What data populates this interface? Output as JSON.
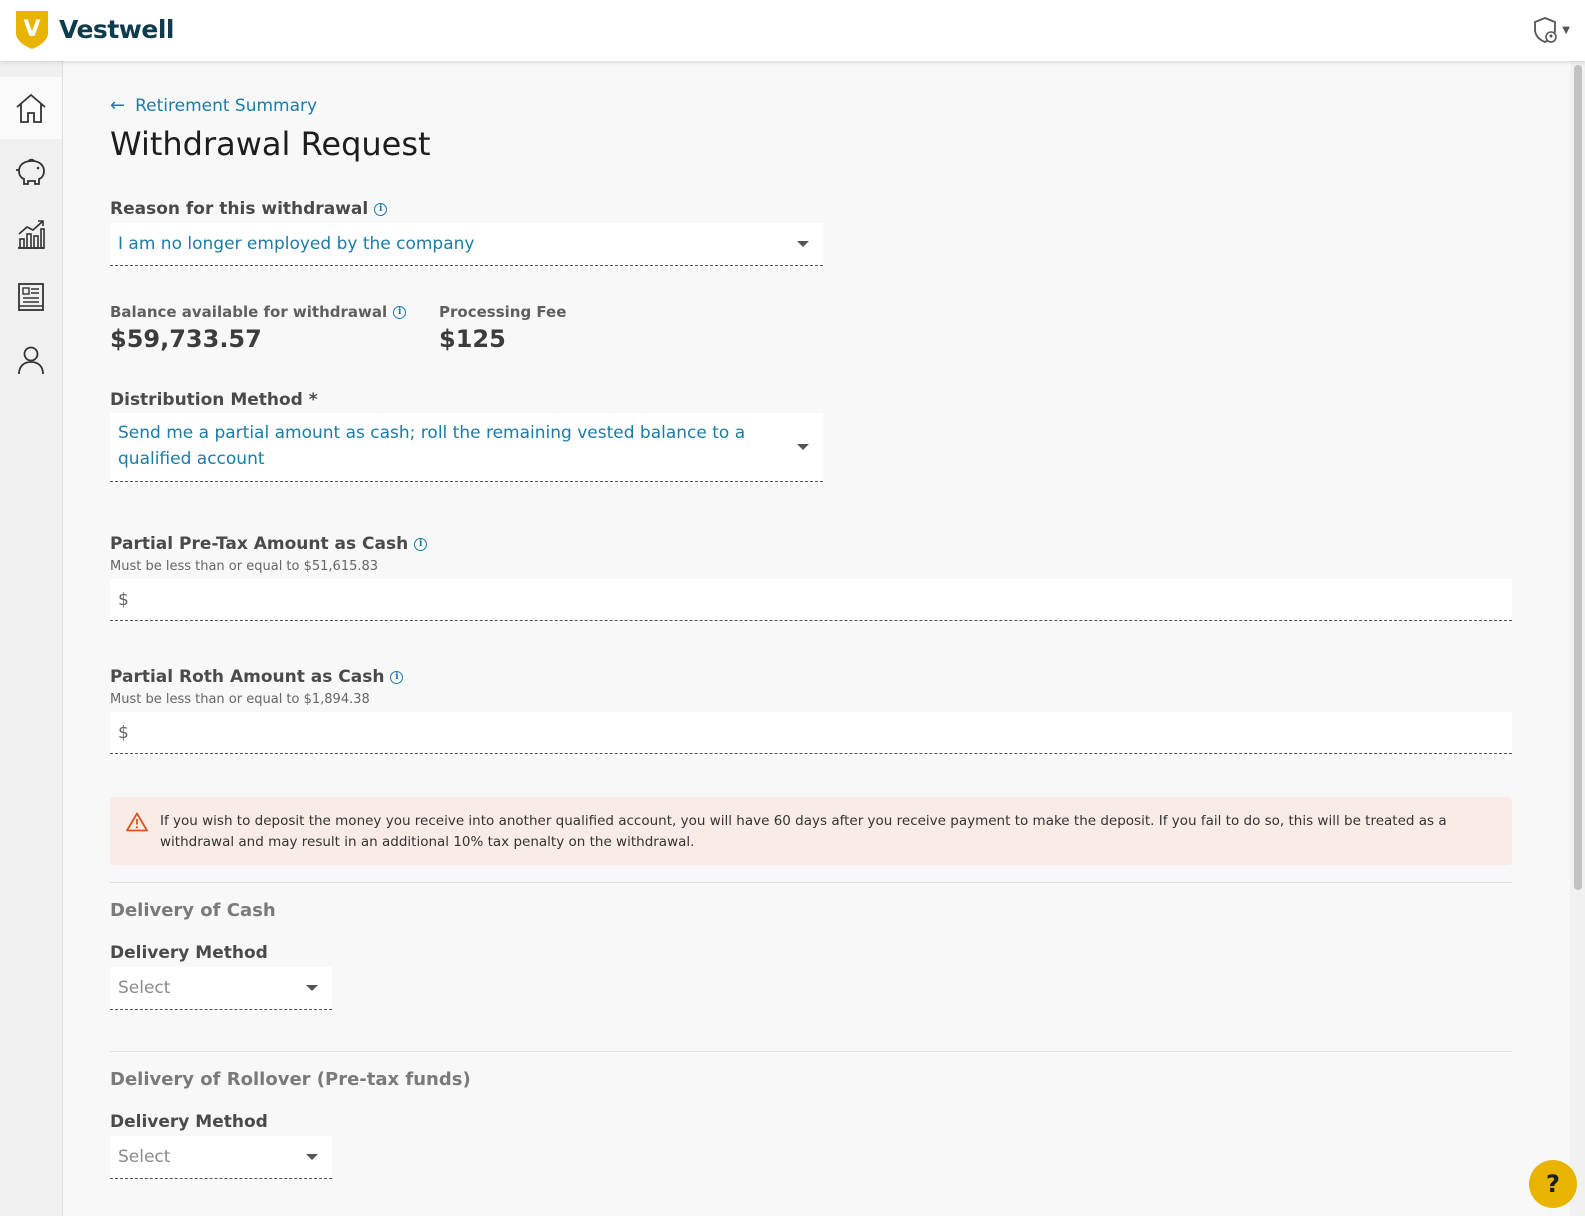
{
  "app": {
    "brand": "Vestwell",
    "logo_letter": "V",
    "colors": {
      "accent": "#1a7ca8",
      "brand_gold": "#e8b400",
      "navy": "#0f3b4f",
      "warning_bg": "#f9ece6",
      "warning_icon": "#d9531e"
    }
  },
  "sidebar": {
    "items": [
      {
        "icon": "home-icon"
      },
      {
        "icon": "piggy-bank-icon"
      },
      {
        "icon": "chart-icon"
      },
      {
        "icon": "document-icon"
      },
      {
        "icon": "user-icon"
      }
    ]
  },
  "page": {
    "back_link": "Retirement Summary",
    "title": "Withdrawal Request"
  },
  "form": {
    "reason": {
      "label": "Reason for this withdrawal",
      "value": "I am no longer employed by the company"
    },
    "balance": {
      "label": "Balance available for withdrawal",
      "value": "$59,733.57"
    },
    "fee": {
      "label": "Processing Fee",
      "value": "$125"
    },
    "distribution": {
      "label": "Distribution Method *",
      "value": "Send me a partial amount as cash; roll the remaining vested balance to a qualified account"
    },
    "pretax": {
      "label": "Partial Pre-Tax Amount as Cash",
      "hint": "Must be less than or equal to $51,615.83",
      "prefix": "$"
    },
    "roth": {
      "label": "Partial Roth Amount as Cash",
      "hint": "Must be less than or equal to $1,894.38",
      "prefix": "$"
    },
    "warning": "If you wish to deposit the money you receive into another qualified account, you will have 60 days after you receive payment to make the deposit. If you fail to do so, this will be treated as a withdrawal and may result in an additional 10% tax penalty on the withdrawal.",
    "cash_section": {
      "title": "Delivery of Cash",
      "method_label": "Delivery Method",
      "method_placeholder": "Select"
    },
    "rollover_section": {
      "title": "Delivery of Rollover (Pre-tax funds)",
      "method_label": "Delivery Method",
      "method_placeholder": "Select"
    }
  },
  "help": {
    "label": "?"
  }
}
